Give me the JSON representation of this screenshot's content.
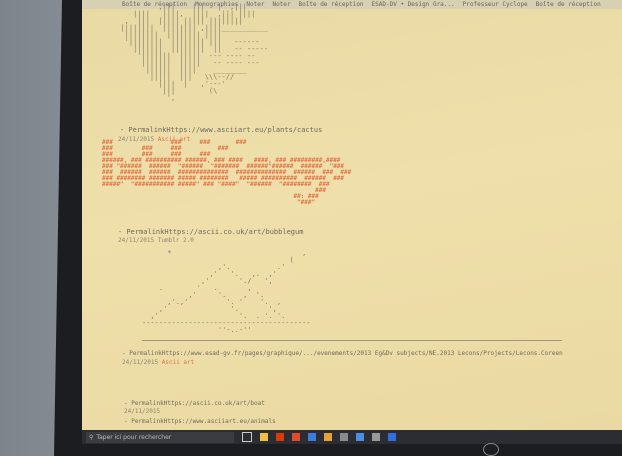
{
  "bookmarks": [
    "Boîte de réception",
    "Monographies",
    "Noter",
    "Noter",
    "Boîte de réception",
    "ESAD-DV • Design Gra...",
    "Professeur Cyclope",
    "Boîte de réception"
  ],
  "art1_text": "           ,|||    |||   |  ,|||\n     ||||   ||||,  ||||  ,||| ||||\n   ,  |||  ||||| ||||| ||||||||\n  ||||||||  |||||||| ,||||___________\n   ||||||||  |||||||| ||||\n   '||||||||  |||||||| |||   ------\n     |||||||  ||||||||  ||   -- -----\n      '|||||||  |||||  --- ---- --\n       |||||||  |||||   -- ---- ---\n        ||||||  ||||    ________\n         |||||  |||   \\\\\\--//\n           ||||  |   ,'---'\n            |||        (\\\n             ',",
  "permalink1": "- PermalinkHttps://www.asciiart.eu/plants/cactus",
  "date1": "24/11/2015",
  "date1_tag": "Ascii art",
  "art2_text": "###                ###     ###       ###\n###        ###     ###          ###\n###        ###     ###     ###\n######, ### ########## ######, ### ####   ####, ### #########,####\n### \"######  ######  \"######  \"#######  ######\"######  ######  \"###\n###  ######  ######  ##############  ##############  ######  ###  ###\n### ######## ####### ##### ########   ##### ##########  ######  ###\n#####\"  \"########### #####\" ### \"####\"  \"######  \"########  ###\n                                                           ###\n                                                     ##: ###\n                                                      \"###\"",
  "permalink2": "- PermalinkHttps://ascii.co.uk/art/bubblegum",
  "date2": "24/11/2015",
  "date2_tag": "Tumblr 2.0",
  "art3_text": "      *                               ,\n                                   (\n                  ,'.           .'\n                ,'   '.   ,.  ,'\n              ,'       './   ',\n    .        '   .       ,\n           ,'     '.    ,  '.\n      ,'.,'         '. '    '.  ,\n    ,'               '.       ',\n  ,'                   '.  . '. '.\n----------------------------------------\n                  ''-..-''",
  "permalink3": "- PermalinkHttps://www.esad-gv.fr/pages/graphique/.../evenements/2013 Eg&Dv subjects/NE.2013 Lecons/Projects/Lecons.Coreen",
  "date3": "24/11/2015",
  "date3_tag": "Ascii art",
  "permalink4": "- PermalinkHttps://ascii.co.uk/art/boat",
  "date4": "24/11/2015",
  "permalink5": "- PermalinkHttps://www.asciiart.eu/animals",
  "taskbar": {
    "search_placeholder": "Taper ici pour rechercher"
  }
}
